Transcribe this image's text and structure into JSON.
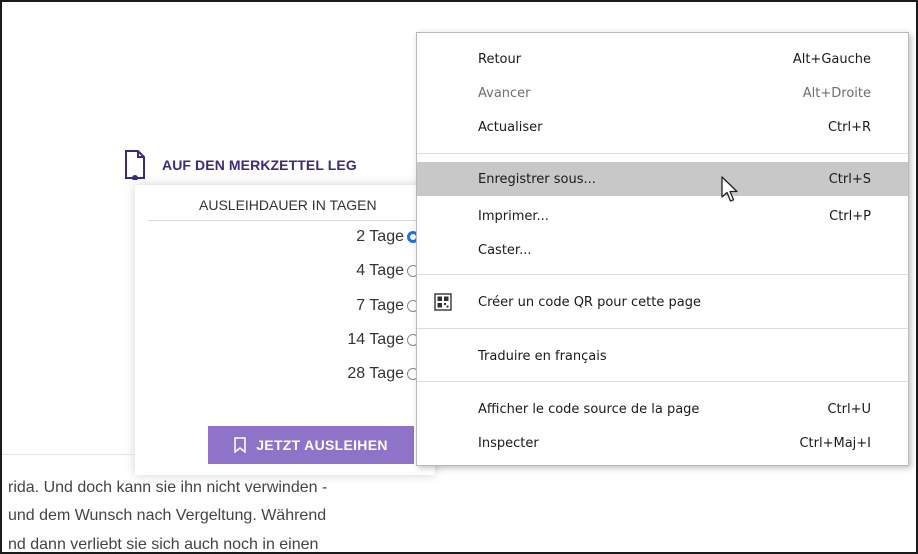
{
  "page": {
    "merkzettel_label": "AUF DEN MERKZETTEL LEG",
    "loan_panel": {
      "title": "AUSLEIHDAUER IN TAGEN",
      "options": [
        {
          "label": "2 Tage",
          "selected": true
        },
        {
          "label": "4 Tage",
          "selected": false
        },
        {
          "label": "7 Tage",
          "selected": false
        },
        {
          "label": "14 Tage",
          "selected": false
        },
        {
          "label": "28 Tage",
          "selected": false
        }
      ],
      "rent_button_label": "JETZT AUSLEIHEN"
    },
    "body_lines": [
      "rida. Und doch kann sie ihn nicht verwinden -",
      "und dem Wunsch nach Vergeltung. Während",
      "nd dann verliebt sie sich auch noch in einen"
    ],
    "accent_color": "#8f73c8",
    "title_color": "#3d2a7a"
  },
  "context_menu": {
    "items": [
      {
        "label": "Retour",
        "shortcut": "Alt+Gauche",
        "disabled": false
      },
      {
        "label": "Avancer",
        "shortcut": "Alt+Droite",
        "disabled": true
      },
      {
        "label": "Actualiser",
        "shortcut": "Ctrl+R",
        "disabled": false
      },
      {
        "label": "Enregistrer sous...",
        "shortcut": "Ctrl+S",
        "highlighted": true
      },
      {
        "label": "Imprimer...",
        "shortcut": "Ctrl+P"
      },
      {
        "label": "Caster..."
      },
      {
        "label": "Créer un code QR pour cette page",
        "icon": "qr-code-icon"
      },
      {
        "label": "Traduire en français"
      },
      {
        "label": "Afficher le code source de la page",
        "shortcut": "Ctrl+U"
      },
      {
        "label": "Inspecter",
        "shortcut": "Ctrl+Maj+I"
      }
    ],
    "highlight_color": "#c8c8c8"
  }
}
